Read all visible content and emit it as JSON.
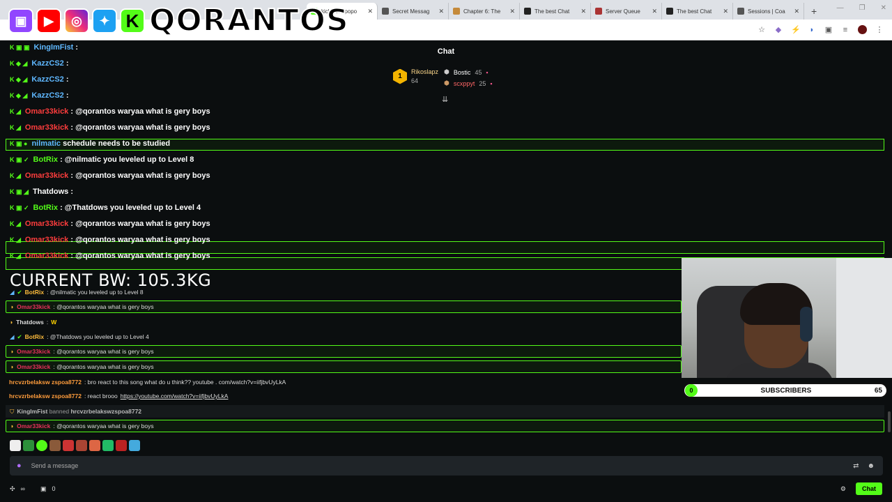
{
  "tabs": [
    {
      "title": "kick.com/popo",
      "active": true
    },
    {
      "title": "Secret Messag"
    },
    {
      "title": "Chapter 6: The"
    },
    {
      "title": "The best Chat"
    },
    {
      "title": "Server Queue"
    },
    {
      "title": "The best Chat"
    },
    {
      "title": "Sessions | Coa"
    }
  ],
  "brand": "QORANTOS",
  "chat": {
    "title": "Chat",
    "leaderboard": {
      "rank": "1",
      "top": {
        "name": "Rikoslapz",
        "count": "64"
      },
      "others": [
        {
          "name": "Bostic",
          "count": "45"
        },
        {
          "name": "scxppyt",
          "count": "25"
        }
      ]
    }
  },
  "overlay_chat": [
    {
      "user": "KingImFist",
      "text": ":",
      "color": "c"
    },
    {
      "user": "KazzCS2",
      "text": ":",
      "color": "c"
    },
    {
      "user": "KazzCS2",
      "text": ":",
      "color": "c"
    },
    {
      "user": "KazzCS2",
      "text": ":",
      "color": "c"
    },
    {
      "user": "Omar33kick",
      "text": ": @qorantos waryaa what is gery boys",
      "color": "r"
    },
    {
      "user": "Omar33kick",
      "text": ": @qorantos waryaa what is gery boys",
      "color": "r"
    },
    {
      "user": "nilmatic",
      "text": "schedule needs to be studied",
      "color": "c"
    },
    {
      "user": "BotRix",
      "text": ": @nilmatic you leveled up to Level 8",
      "color": "k"
    },
    {
      "user": "Omar33kick",
      "text": ": @qorantos waryaa what is gery boys",
      "color": "r"
    },
    {
      "user": "Thatdows",
      "text": ":",
      "color": "w"
    },
    {
      "user": "BotRix",
      "text": ": @Thatdows you leveled up to Level 4",
      "color": "k"
    },
    {
      "user": "Omar33kick",
      "text": ": @qorantos waryaa what is gery boys",
      "color": "r"
    },
    {
      "user": "Omar33kick",
      "text": ": @qorantos waryaa what is gery boys",
      "color": "r"
    },
    {
      "user": "Omar33kick",
      "text": ": @qorantos waryaa what is gery boys",
      "color": "r"
    }
  ],
  "bw_label": "CURRENT BW: 105.3KG",
  "native_chat": {
    "botrix_1": {
      "user": "BotRix",
      "text": ": @nilmatic you leveled up to Level 8"
    },
    "omar_1": {
      "user": "Omar33kick",
      "text": ": @qorantos waryaa what is gery boys"
    },
    "thatdows": {
      "user": "Thatdows",
      "text": ":"
    },
    "botrix_2": {
      "user": "BotRix",
      "text": ": @Thatdows you leveled up to Level 4"
    },
    "omar_2": {
      "user": "Omar33kick",
      "text": ": @qorantos waryaa what is gery boys"
    },
    "omar_3": {
      "user": "Omar33kick",
      "text": ": @qorantos waryaa what is gery boys"
    },
    "hrc_1": {
      "user": "hrcvzrbelaksw zspoa8772",
      "text": ": bro react to this song what do u think?? youtube . com/watch?v=iifjbvUyLkA"
    },
    "hrc_2": {
      "user": "hrcvzrbelaksw zspoa8772",
      "text": ": react brooo",
      "link": "https://youtube.com/watch?v=iifjbvUyLkA"
    },
    "ban": {
      "mod": "KingImFist",
      "verb": "banned",
      "target": "hrcvzrbelakswzspoa8772"
    },
    "omar_4": {
      "user": "Omar33kick",
      "text": ": @qorantos waryaa what is gery boys"
    }
  },
  "subscribers": {
    "left": "0",
    "label": "SUBSCRIBERS",
    "right": "65"
  },
  "input": {
    "placeholder": "Send a message"
  },
  "footer": {
    "points": "0",
    "chat_button": "Chat"
  },
  "colors": {
    "kick_green": "#53fc18",
    "omar_red": "#e9305b",
    "bg": "#0b0e0f"
  }
}
